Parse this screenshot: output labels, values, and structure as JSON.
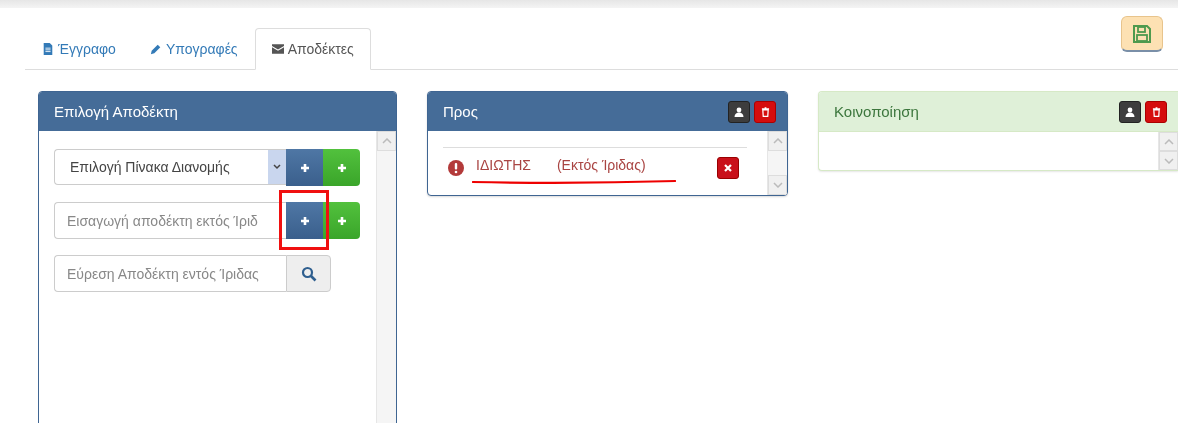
{
  "tabs": [
    {
      "label": "Έγγραφο",
      "kind": "document",
      "selected": false
    },
    {
      "label": "Υπογραφές",
      "kind": "signatures",
      "selected": false
    },
    {
      "label": "Αποδέκτες",
      "kind": "recipients",
      "selected": true
    }
  ],
  "picker_panel": {
    "title": "Επιλογή Αποδέκτη",
    "distribution_select": {
      "value": "Επιλογή Πίνακα Διανομής"
    },
    "external_field": {
      "placeholder": "Εισαγωγή αποδέκτη εκτός Ίριδ"
    },
    "search_field": {
      "placeholder": "Εύρεση Αποδέκτη εντός Ίριδας"
    }
  },
  "to_panel": {
    "title": "Προς",
    "recipients": [
      {
        "name": "ΙΔΙΩΤΗΣ",
        "note": "(Εκτός Ίριδας)"
      }
    ]
  },
  "cc_panel": {
    "title": "Κοινοποίηση"
  }
}
